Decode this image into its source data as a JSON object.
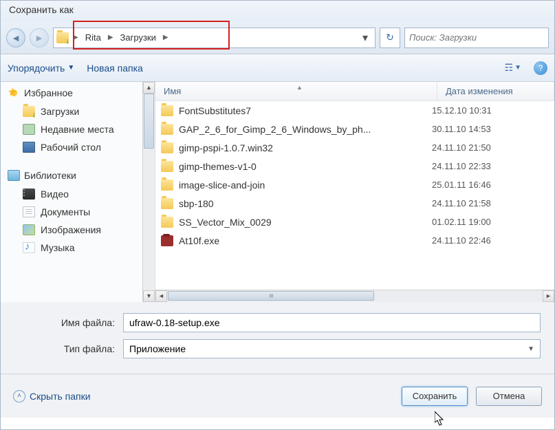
{
  "title": "Сохранить как",
  "breadcrumb": {
    "seg1": "Rita",
    "seg2": "Загрузки"
  },
  "search_placeholder": "Поиск: Загрузки",
  "toolbar": {
    "organize": "Упорядочить",
    "new_folder": "Новая папка"
  },
  "sidebar": {
    "favorites_header": "Избранное",
    "favorites": [
      {
        "label": "Загрузки"
      },
      {
        "label": "Недавние места"
      },
      {
        "label": "Рабочий стол"
      }
    ],
    "libraries_header": "Библиотеки",
    "libraries": [
      {
        "label": "Видео"
      },
      {
        "label": "Документы"
      },
      {
        "label": "Изображения"
      },
      {
        "label": "Музыка"
      }
    ]
  },
  "columns": {
    "name": "Имя",
    "date": "Дата изменения"
  },
  "files": [
    {
      "name": "FontSubstitutes7",
      "date": "15.12.10 10:31",
      "type": "folder"
    },
    {
      "name": "GAP_2_6_for_Gimp_2_6_Windows_by_ph...",
      "date": "30.11.10 14:53",
      "type": "folder"
    },
    {
      "name": "gimp-pspi-1.0.7.win32",
      "date": "24.11.10 21:50",
      "type": "folder"
    },
    {
      "name": "gimp-themes-v1-0",
      "date": "24.11.10 22:33",
      "type": "folder"
    },
    {
      "name": "image-slice-and-join",
      "date": "25.01.11 16:46",
      "type": "folder"
    },
    {
      "name": "sbp-180",
      "date": "24.11.10 21:58",
      "type": "folder"
    },
    {
      "name": "SS_Vector_Mix_0029",
      "date": "01.02.11 19:00",
      "type": "folder"
    },
    {
      "name": "At10f.exe",
      "date": "24.11.10 22:46",
      "type": "exe"
    }
  ],
  "form": {
    "filename_label": "Имя файла:",
    "filename_value": "ufraw-0.18-setup.exe",
    "filetype_label": "Тип файла:",
    "filetype_value": "Приложение"
  },
  "footer": {
    "hide_folders": "Скрыть папки",
    "save": "Сохранить",
    "cancel": "Отмена"
  }
}
